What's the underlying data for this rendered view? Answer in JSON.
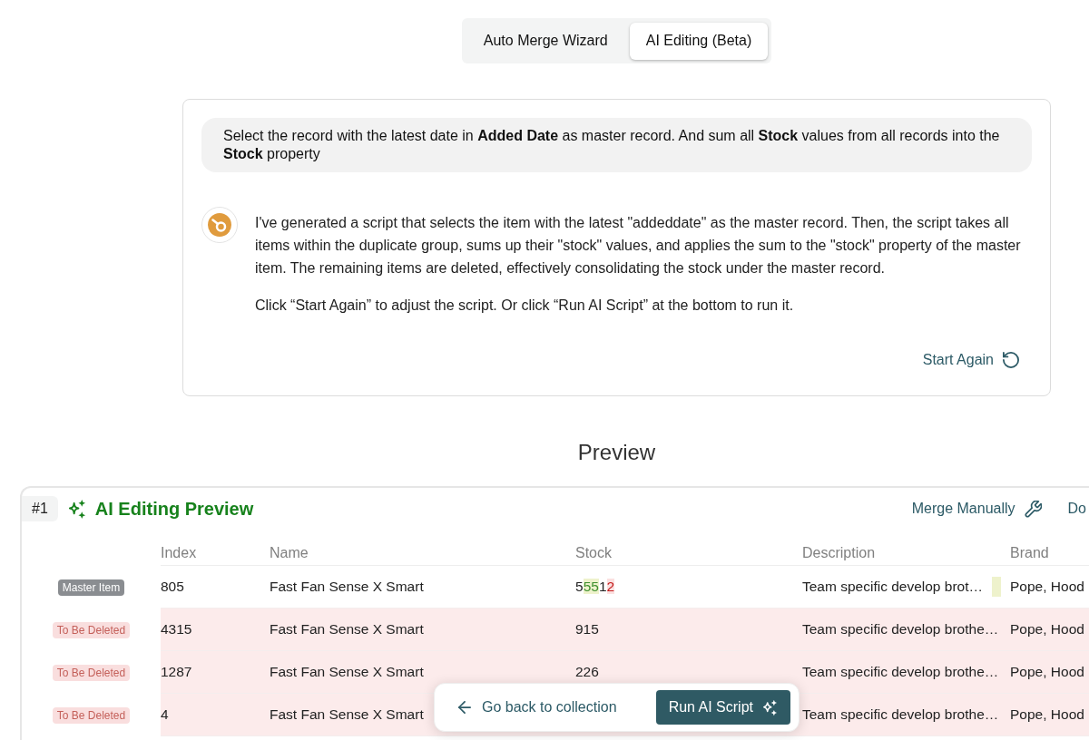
{
  "tabs": [
    {
      "label": "Auto Merge Wizard",
      "selected": false
    },
    {
      "label": "AI Editing (Beta)",
      "selected": true
    }
  ],
  "prompt": "Select the record with the latest date in **Added Date** as master record. And sum all **Stock** values from all records into the **Stock** property",
  "response": {
    "paragraphs": [
      "I've generated a script that selects the item with the latest \"addeddate\" as the master record. Then, the script takes all items within the duplicate group, sums up their \"stock\" values, and applies the sum to the \"stock\" property of the master item. The remaining items are deleted, effectively consolidating the stock under the master record.",
      "Click “Start Again” to adjust the script. Or click “Run AI Script” at the bottom to run it."
    ],
    "action": "Start Again"
  },
  "preview": {
    "heading": "Preview",
    "group": {
      "number": "#1",
      "title": "AI Editing Preview",
      "actions": [
        {
          "label": "Merge Manually",
          "kind": "wrench"
        },
        {
          "label": "Do",
          "kind": "plain"
        }
      ]
    },
    "table": {
      "columns": [
        "Index",
        "Name",
        "Stock",
        "Description",
        "Brand"
      ],
      "rows": [
        {
          "kind": "master",
          "label": "Master Item",
          "index": "805",
          "name": "Fast Fan Sense X Smart",
          "stock": [
            {
              "text": "5",
              "kind": "same"
            },
            {
              "text": "55",
              "kind": "added"
            },
            {
              "text": "1",
              "kind": "same"
            },
            {
              "text": "2",
              "kind": "removed"
            }
          ],
          "description": {
            "text": "Team specific develop brot…",
            "changed": true
          },
          "brand": "Pope, Hood"
        },
        {
          "kind": "delete",
          "label": "To Be Deleted",
          "index": "4315",
          "name": "Fast Fan Sense X Smart",
          "stock": [
            {
              "text": "915",
              "kind": "same"
            }
          ],
          "description": {
            "text": "Team specific develop brothe…",
            "changed": false
          },
          "brand": "Pope, Hood"
        },
        {
          "kind": "delete",
          "label": "To Be Deleted",
          "index": "1287",
          "name": "Fast Fan Sense X Smart",
          "stock": [
            {
              "text": "226",
              "kind": "same"
            }
          ],
          "description": {
            "text": "Team specific develop brothe…",
            "changed": false
          },
          "brand": "Pope, Hood"
        },
        {
          "kind": "delete",
          "label": "To Be Deleted",
          "index": "4",
          "name": "Fast Fan Sense X Smart",
          "description": {
            "text": "Team specific develop brothe…",
            "changed": false
          },
          "brand": "Pope, Hood"
        }
      ]
    }
  },
  "action_bar": {
    "back": "Go back to collection",
    "run": "Run AI Script"
  }
}
